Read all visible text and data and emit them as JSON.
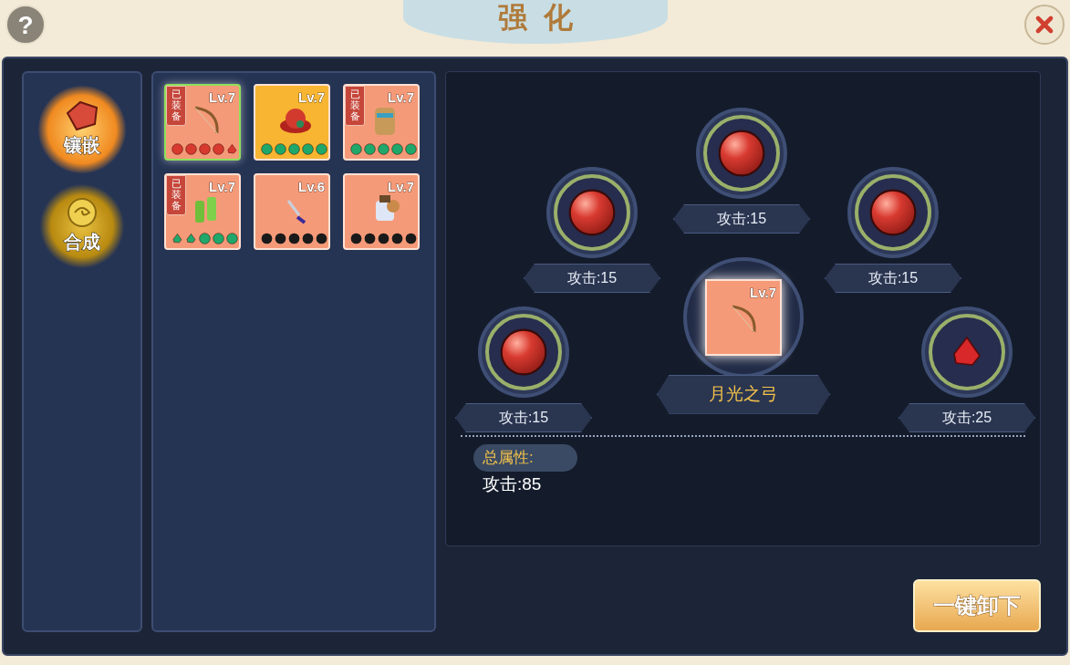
{
  "window": {
    "title": "强化",
    "help": "?"
  },
  "side_tabs": [
    {
      "label": "镶嵌",
      "kind": "inlay",
      "selected": true
    },
    {
      "label": "合成",
      "kind": "synth",
      "selected": false
    }
  ],
  "items": [
    {
      "kind": "bow",
      "level": "Lv.7",
      "tag": "已装备",
      "color": "#f59a78",
      "selected": true,
      "gems": [
        {
          "kind": "orb",
          "color": "#d83a30"
        },
        {
          "kind": "orb",
          "color": "#d83a30"
        },
        {
          "kind": "orb",
          "color": "#d83a30"
        },
        {
          "kind": "orb",
          "color": "#d83a30"
        },
        {
          "kind": "shard",
          "color": "#d83a30"
        }
      ]
    },
    {
      "kind": "hat",
      "level": "Lv.7",
      "color": "#f7b531",
      "selected": false,
      "gems": [
        {
          "kind": "orb",
          "color": "#1fa86a"
        },
        {
          "kind": "orb",
          "color": "#1fa86a"
        },
        {
          "kind": "orb",
          "color": "#1fa86a"
        },
        {
          "kind": "orb",
          "color": "#1fa86a"
        },
        {
          "kind": "orb",
          "color": "#1fa86a"
        }
      ]
    },
    {
      "kind": "armor",
      "level": "Lv.7",
      "tag": "已装备",
      "color": "#f59a78",
      "selected": false,
      "gems": [
        {
          "kind": "orb",
          "color": "#1fa86a"
        },
        {
          "kind": "orb",
          "color": "#1fa86a"
        },
        {
          "kind": "orb",
          "color": "#1fa86a"
        },
        {
          "kind": "orb",
          "color": "#1fa86a"
        },
        {
          "kind": "orb",
          "color": "#1fa86a"
        }
      ]
    },
    {
      "kind": "boots",
      "level": "Lv.7",
      "tag": "已装备",
      "color": "#f59a78",
      "selected": false,
      "gems": [
        {
          "kind": "shard",
          "color": "#1fa86a"
        },
        {
          "kind": "shard",
          "color": "#1fa86a"
        },
        {
          "kind": "orb",
          "color": "#1fa86a"
        },
        {
          "kind": "orb",
          "color": "#1fa86a"
        },
        {
          "kind": "orb",
          "color": "#1fa86a"
        }
      ]
    },
    {
      "kind": "dagger",
      "level": "Lv.6",
      "color": "#f59a78",
      "selected": false,
      "gems": [
        {
          "kind": "empty",
          "color": "#1a1a1a"
        },
        {
          "kind": "empty",
          "color": "#1a1a1a"
        },
        {
          "kind": "empty",
          "color": "#1a1a1a"
        },
        {
          "kind": "empty",
          "color": "#1a1a1a"
        },
        {
          "kind": "empty",
          "color": "#1a1a1a"
        }
      ]
    },
    {
      "kind": "mech",
      "level": "Lv.7",
      "color": "#f59a78",
      "selected": false,
      "gems": [
        {
          "kind": "empty",
          "color": "#1a1a1a"
        },
        {
          "kind": "empty",
          "color": "#1a1a1a"
        },
        {
          "kind": "empty",
          "color": "#1a1a1a"
        },
        {
          "kind": "empty",
          "color": "#1a1a1a"
        },
        {
          "kind": "empty",
          "color": "#1a1a1a"
        }
      ]
    }
  ],
  "sockets": [
    {
      "gem": {
        "kind": "orb"
      },
      "stat": "攻击:15"
    },
    {
      "gem": {
        "kind": "orb"
      },
      "stat": "攻击:15"
    },
    {
      "gem": {
        "kind": "orb"
      },
      "stat": "攻击:15"
    },
    {
      "gem": {
        "kind": "orb"
      },
      "stat": "攻击:15"
    },
    {
      "gem": {
        "kind": "shard"
      },
      "stat": "攻击:25"
    }
  ],
  "center_item": {
    "kind": "bow",
    "level": "Lv.7",
    "name": "月光之弓"
  },
  "totals": {
    "label": "总属性:",
    "value": "攻击:85"
  },
  "unequip_button": "一键卸下"
}
